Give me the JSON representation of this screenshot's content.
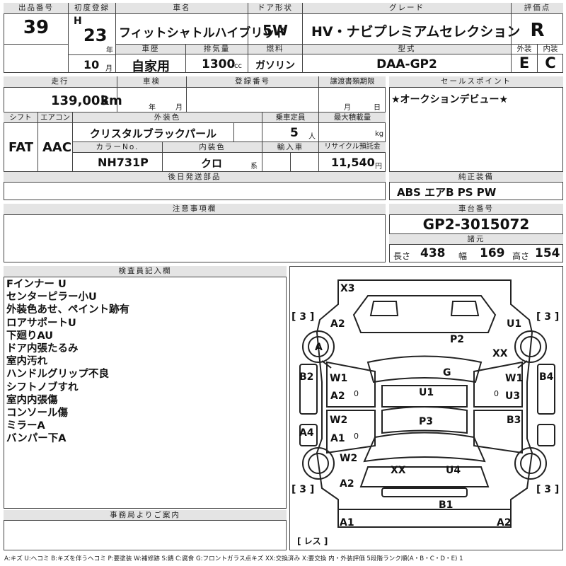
{
  "header": {
    "lot_no_label": "出品番号",
    "lot_no": "39",
    "first_reg_label": "初度登録",
    "era": "H",
    "year": "23",
    "year_unit": "年",
    "month": "10",
    "month_unit": "月",
    "car_name_label": "車名",
    "car_name": "フィットシャトルハイブリッド",
    "doors_label": "ドア形状",
    "doors": "5W",
    "grade_label": "グレード",
    "grade": "HV・ナビプレミアムセレクション",
    "score_label": "評価点",
    "score": "R",
    "history_label": "車歴",
    "history": "自家用",
    "displacement_label": "排気量",
    "displacement": "1300",
    "displacement_unit": "cc",
    "fuel_label": "燃料",
    "fuel": "ガソリン",
    "model_label": "型式",
    "model": "DAA-GP2",
    "exterior_label": "外装",
    "exterior_grade": "E",
    "interior_label": "内装",
    "interior_grade": "C"
  },
  "details": {
    "mileage_label": "走行",
    "mileage": "139,003",
    "mileage_unit": "km",
    "inspection_label": "車検",
    "year_unit": "年",
    "month_unit": "月",
    "reg_no_label": "登録番号",
    "transfer_label": "譲渡書類期限",
    "day_unit": "日",
    "shift_label": "シフト",
    "shift": "FAT",
    "ac_label": "エアコン",
    "ac": "AAC",
    "ext_color_label": "外装色",
    "ext_color": "クリスタルブラックパール",
    "color_no_label": "カラーNo.",
    "color_no": "NH731P",
    "int_color_label": "内装色",
    "int_color": "クロ",
    "int_color_unit": "系",
    "capacity_label": "乗車定員",
    "capacity": "5",
    "capacity_unit": "人",
    "max_load_label": "最大積載量",
    "max_load_unit": "kg",
    "import_label": "輸入車",
    "recycle_label": "リサイクル預託金",
    "recycle": "11,540",
    "recycle_unit": "円",
    "later_parts_label": "後日発送部品"
  },
  "sales_point": {
    "label": "セールスポイント",
    "text": "★オークションデビュー★"
  },
  "equipment": {
    "label": "純正装備",
    "text": "ABS エアB PS PW"
  },
  "notes": {
    "label": "注意事項欄"
  },
  "chassis": {
    "label": "車台番号",
    "number": "GP2-3015072",
    "spec_label": "諸元",
    "length_label": "長さ",
    "length": "438",
    "width_label": "幅",
    "width": "169",
    "height_label": "高さ",
    "height": "154"
  },
  "inspector": {
    "label": "検査員記入欄",
    "lines": [
      "Fインナー U",
      "センターピラー小U",
      "外装色あせ、ペイント跡有",
      "ロアサポートU",
      "下廻りAU",
      "ドア内張たるみ",
      "室内汚れ",
      "ハンドルグリップ不良",
      "シフトノブすれ",
      "室内内張傷",
      "コンソール傷",
      "ミラーA",
      "バンパー下A"
    ]
  },
  "office": {
    "label": "事務局よりご案内"
  },
  "diagram": {
    "labels": {
      "x3": "X3",
      "a2_fl": "A2",
      "u1_fr": "U1",
      "a_wheel_fl": "A",
      "p2": "P2",
      "xx_fr": "XX",
      "b2": "B2",
      "w1_l": "W1",
      "g": "G",
      "w1_r": "W1",
      "b4": "B4",
      "a2_l": "A2",
      "u1_c": "U1",
      "u3": "U3",
      "p3": "P3",
      "w2_l": "W2",
      "b3": "B3",
      "a4": "A4",
      "a1_l": "A1",
      "w2_rl": "W2",
      "xx_rear": "XX",
      "u4": "U4",
      "a2_rl": "A2",
      "b1": "B1",
      "a1_bottom": "A1",
      "a2_bottom": "A2",
      "small_zero": "0"
    },
    "bracket_tl": "[ 3 ]",
    "bracket_tr": "[ 3 ]",
    "bracket_bl": "[ 3 ]",
    "bracket_br": "[ 3 ]",
    "bracket_less": "[ レス ]"
  },
  "legend": "A:キズ U:ヘコミ B:キズを伴うヘコミ P:要塗装 W:補修跡 S:錆 C:腐食 G:フロントガラス点キズ XX:交換済み X:要交換 内・外装評価 5段階ランク順(A・B・C・D・E) 1"
}
